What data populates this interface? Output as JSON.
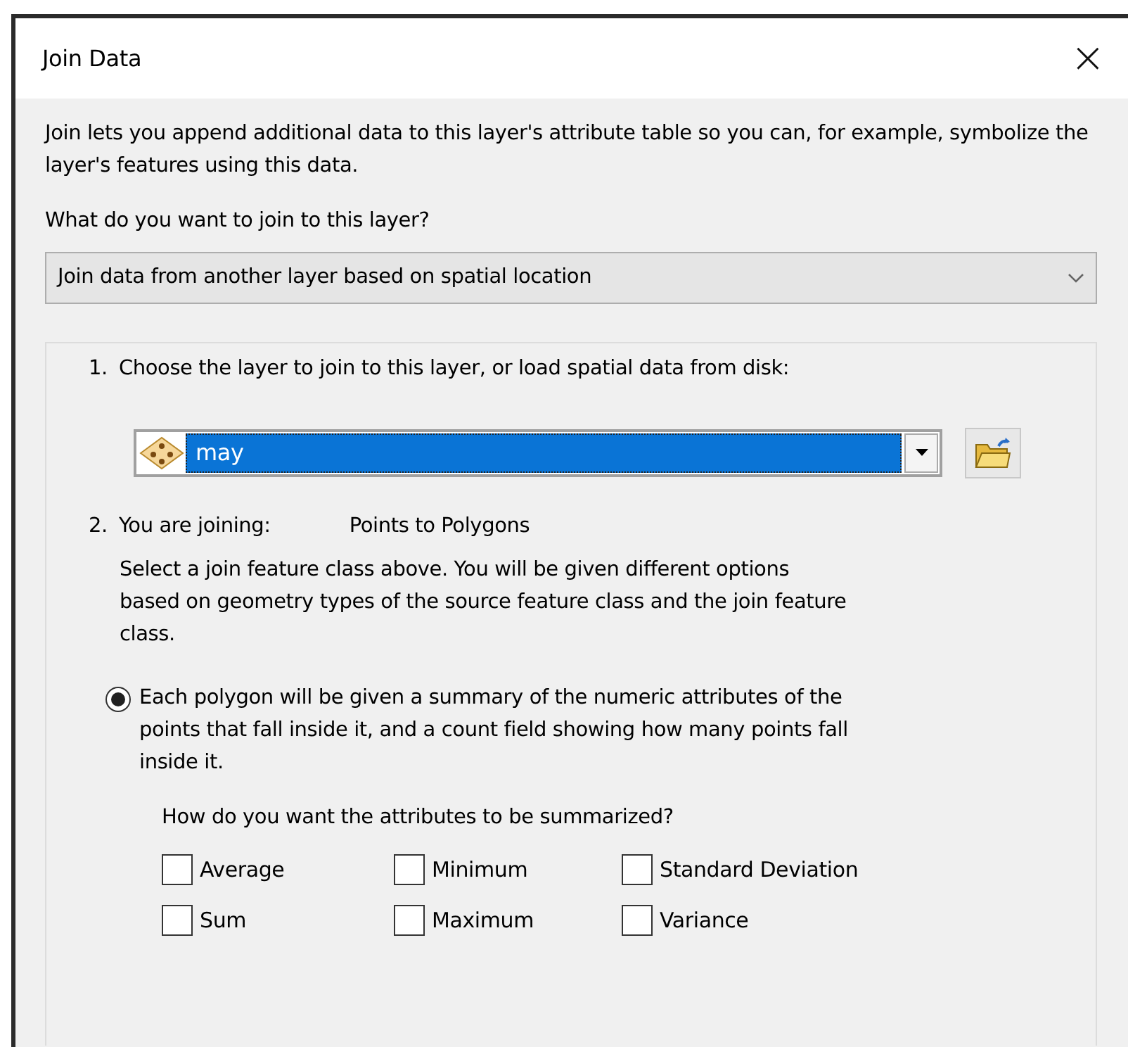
{
  "window": {
    "title": "Join Data",
    "close": "×"
  },
  "intro": "Join lets you append additional data to this layer's attribute table so you can, for example, symbolize the layer's features using this data.",
  "join_question": "What do you want to join to this layer?",
  "join_type": {
    "value": "Join data from another layer based on spatial location"
  },
  "step_1": {
    "number": "1.",
    "label": "Choose the layer to join to this layer, or load spatial data from disk:",
    "layer": {
      "value": "may",
      "selected": true
    }
  },
  "step_2": {
    "number": "2.",
    "label": "You are joining:",
    "value": "Points to Polygons",
    "description": "Select a join feature class above.  You will be given different options based on geometry types of the source feature class and the join feature class."
  },
  "options": [
    {
      "label": "Each polygon will be given a summary of the numeric attributes of the points that fall inside it, and a count field showing how many points fall inside it.",
      "selected": true
    }
  ],
  "summary_question": "How do you want the attributes to be summarized?",
  "summaries": [
    {
      "label": "Average",
      "checked": false
    },
    {
      "label": "Minimum",
      "checked": false
    },
    {
      "label": "Standard Deviation",
      "checked": false
    },
    {
      "label": "Sum",
      "checked": false
    },
    {
      "label": "Maximum",
      "checked": false
    },
    {
      "label": "Variance",
      "checked": false
    }
  ]
}
